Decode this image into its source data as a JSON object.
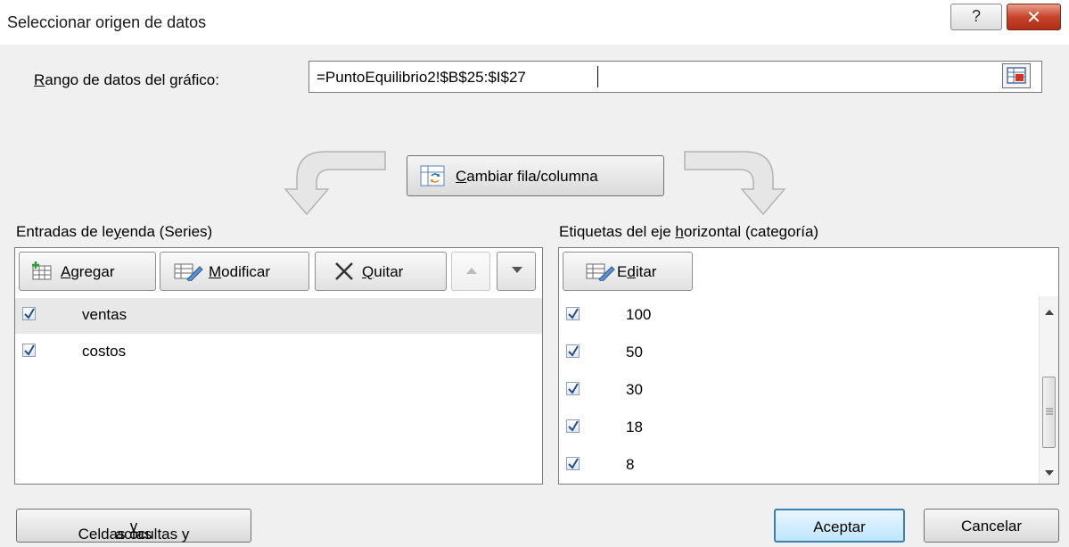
{
  "window": {
    "title": "Seleccionar origen de datos",
    "help_label": "?",
    "close_label": "✕"
  },
  "range": {
    "label_pre": "",
    "label_u": "R",
    "label_post": "ango de datos del gráfico:",
    "value": "=PuntoEquilibrio2!$B$25:$I$27"
  },
  "switch_button": {
    "u": "C",
    "rest": "ambiar fila/columna"
  },
  "legend_panel": {
    "label_pre": "Entradas de le",
    "label_u": "y",
    "label_post": "enda (Series)",
    "add": {
      "u": "A",
      "rest": "gregar"
    },
    "edit": {
      "u": "M",
      "rest": "odificar"
    },
    "remove": {
      "u": "Q",
      "rest": "uitar"
    },
    "items": [
      {
        "label": "ventas",
        "checked": true,
        "selected": true
      },
      {
        "label": "costos",
        "checked": true,
        "selected": false
      }
    ]
  },
  "axis_panel": {
    "label_pre": "Etiquetas del eje ",
    "label_u": "h",
    "label_post": "orizontal (categoría)",
    "edit": {
      "pre": "E",
      "u": "d",
      "rest": "itar"
    },
    "items": [
      {
        "label": "100",
        "checked": true
      },
      {
        "label": "50",
        "checked": true
      },
      {
        "label": "30",
        "checked": true
      },
      {
        "label": "18",
        "checked": true
      },
      {
        "label": "8",
        "checked": true
      }
    ]
  },
  "bottom": {
    "hidden_cells": {
      "pre": "Celdas ocultas y ",
      "u": "v",
      "rest": "acías"
    },
    "ok": "Aceptar",
    "cancel": "Cancelar"
  }
}
